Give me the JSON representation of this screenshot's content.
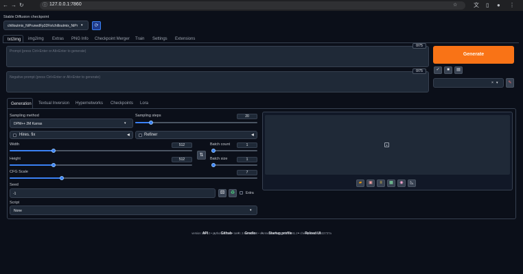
{
  "browser": {
    "url": "127.0.0.1:7860",
    "icons": [
      "back-icon",
      "forward-icon",
      "reload-icon",
      "info-icon",
      "translate-icon",
      "bookmark-star-icon",
      "side-panel-icon",
      "profile-icon",
      "menu-kebab-icon"
    ]
  },
  "checkpoint": {
    "label": "Stable Diffusion checkpoint",
    "value": "chilloutmix_NiPrunedFp32Fix\\chilloutmix_NiPr",
    "refresh_icon": "refresh-icon"
  },
  "main_tabs": [
    "txt2img",
    "img2img",
    "Extras",
    "PNG Info",
    "Checkpoint Merger",
    "Train",
    "Settings",
    "Extensions"
  ],
  "prompt": {
    "placeholder": "Prompt (press Ctrl+Enter or Alt+Enter to generate)",
    "counter": "0/75"
  },
  "negative_prompt": {
    "placeholder": "Negative prompt (press Ctrl+Enter or Alt+Enter to generate)",
    "counter": "0/75"
  },
  "generate": {
    "label": "Generate"
  },
  "tool_buttons": [
    "check-icon",
    "trash-icon",
    "clipboard-icon"
  ],
  "styles": {
    "clear_glyph": "×",
    "dropdown_glyph": "▾",
    "edit_icon": "pencil-icon"
  },
  "sub_tabs": [
    "Generation",
    "Textual Inversion",
    "Hypernetworks",
    "Checkpoints",
    "Lora"
  ],
  "sampling_method": {
    "label": "Sampling method",
    "value": "DPM++ 2M Karras"
  },
  "sampling_steps": {
    "label": "Sampling steps",
    "value": "20",
    "fraction": 0.13
  },
  "hires_fix": {
    "label": "Hires. fix"
  },
  "refiner": {
    "label": "Refiner"
  },
  "width": {
    "label": "Width",
    "value": "512",
    "fraction": 0.24
  },
  "height": {
    "label": "Height",
    "value": "512",
    "fraction": 0.24
  },
  "swap_icon": "swap-dimensions-icon",
  "batch_count": {
    "label": "Batch count",
    "value": "1",
    "fraction": 0.0
  },
  "batch_size": {
    "label": "Batch size",
    "value": "1",
    "fraction": 0.0
  },
  "cfg_scale": {
    "label": "CFG Scale",
    "value": "7",
    "fraction": 0.21
  },
  "seed": {
    "label": "Seed",
    "value": "-1",
    "extra_label": "Extra"
  },
  "script": {
    "label": "Script",
    "value": "None"
  },
  "output_icons": [
    "folder-icon",
    "save-icon",
    "zip-icon",
    "image-to-image-icon",
    "paint-palette-icon",
    "ruler-icon"
  ],
  "footer": {
    "links": [
      "API",
      "Github",
      "Gradio",
      "Startup profile",
      "Reload UI"
    ],
    "separator": "•",
    "version_line": "version: v1.7.0  •  python: 3.10.6  •  torch: 2.0.1+cu118  •  xformers: N/A  •  gradio: 3.41.2  •  checkpoint: 8c2522737a"
  },
  "colors": {
    "background": "#0b0f19",
    "accent_orange": "#f97316",
    "slider_blue": "#3b82f6"
  }
}
